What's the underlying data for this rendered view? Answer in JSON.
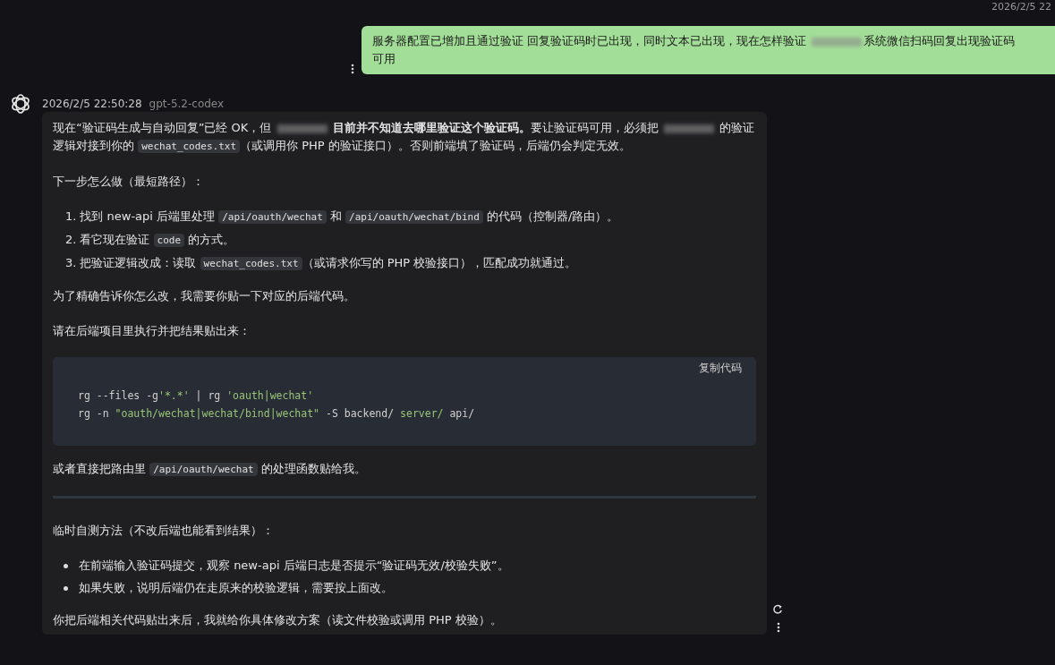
{
  "top_timestamp": "2026/2/5 22",
  "user_message": {
    "lines": [
      [
        {
          "kind": "text",
          "text": "服务器配置已增加且通过验证 回复验证码时已出现，同时文本已出现，现在怎样验证 "
        },
        {
          "kind": "redacted"
        },
        {
          "kind": "text",
          "text": "系统微信扫码回复出现验证码"
        }
      ],
      [
        {
          "kind": "text",
          "text": "可用"
        }
      ]
    ]
  },
  "reply": {
    "timestamp": "2026/2/5 22:50:28",
    "model": "gpt-5.2-codex",
    "blocks": [
      {
        "kind": "paragraph",
        "segments": [
          {
            "kind": "text",
            "text": "现在“验证码生成与自动回复”已经 OK，但 "
          },
          {
            "kind": "redacted"
          },
          {
            "kind": "bold",
            "text": " 目前并不知道去哪里验证这个验证码。"
          },
          {
            "kind": "text",
            "text": "要让验证码可用，必须把 "
          },
          {
            "kind": "redacted"
          },
          {
            "kind": "text",
            "text": " 的验证逻辑对接到你的 "
          },
          {
            "kind": "code",
            "text": "wechat_codes.txt"
          },
          {
            "kind": "text",
            "text": "（或调用你 PHP 的验证接口）。否则前端填了验证码，后端仍会判定无效。"
          }
        ]
      },
      {
        "kind": "paragraph",
        "segments": [
          {
            "kind": "text",
            "text": "下一步怎么做（最短路径）："
          }
        ]
      },
      {
        "kind": "ordered_list",
        "items": [
          {
            "number": "1.",
            "segments": [
              {
                "kind": "text",
                "text": "找到 new-api 后端里处理 "
              },
              {
                "kind": "code",
                "text": "/api/oauth/wechat"
              },
              {
                "kind": "text",
                "text": " 和 "
              },
              {
                "kind": "code",
                "text": "/api/oauth/wechat/bind"
              },
              {
                "kind": "text",
                "text": " 的代码（控制器/路由）。"
              }
            ]
          },
          {
            "number": "2.",
            "segments": [
              {
                "kind": "text",
                "text": "看它现在验证 "
              },
              {
                "kind": "code",
                "text": "code"
              },
              {
                "kind": "text",
                "text": " 的方式。"
              }
            ]
          },
          {
            "number": "3.",
            "segments": [
              {
                "kind": "text",
                "text": "把验证逻辑改成：读取 "
              },
              {
                "kind": "code",
                "text": "wechat_codes.txt"
              },
              {
                "kind": "text",
                "text": "（或请求你写的 PHP 校验接口），匹配成功就通过。"
              }
            ]
          }
        ]
      },
      {
        "kind": "paragraph",
        "segments": [
          {
            "kind": "text",
            "text": "为了精确告诉你怎么改，我需要你贴一下对应的后端代码。"
          }
        ]
      },
      {
        "kind": "paragraph",
        "segments": [
          {
            "kind": "text",
            "text": "请在后端项目里执行并把结果贴出来："
          }
        ]
      },
      {
        "kind": "code_block",
        "copy_label": "复制代码",
        "lines": [
          [
            {
              "kind": "plain",
              "text": "rg --files -g"
            },
            {
              "kind": "string",
              "text": "'*.*'"
            },
            {
              "kind": "plain",
              "text": " | rg "
            },
            {
              "kind": "string",
              "text": "'oauth|wechat'"
            }
          ],
          [
            {
              "kind": "plain",
              "text": "rg -n "
            },
            {
              "kind": "string",
              "text": "\"oauth/wechat|wechat/bind|wechat\""
            },
            {
              "kind": "plain",
              "text": " -S backend/ "
            },
            {
              "kind": "string",
              "text": "server/"
            },
            {
              "kind": "plain",
              "text": " api/"
            }
          ]
        ]
      },
      {
        "kind": "paragraph",
        "segments": [
          {
            "kind": "text",
            "text": "或者直接把路由里 "
          },
          {
            "kind": "code",
            "text": "/api/oauth/wechat"
          },
          {
            "kind": "text",
            "text": " 的处理函数贴给我。"
          }
        ]
      },
      {
        "kind": "divider"
      },
      {
        "kind": "paragraph",
        "segments": [
          {
            "kind": "text",
            "text": "临时自测方法（不改后端也能看到结果）："
          }
        ]
      },
      {
        "kind": "bullet_list",
        "items": [
          {
            "segments": [
              {
                "kind": "text",
                "text": "在前端输入验证码提交，观察 new-api 后端日志是否提示“验证码无效/校验失败”。"
              }
            ]
          },
          {
            "segments": [
              {
                "kind": "text",
                "text": "如果失败，说明后端仍在走原来的校验逻辑，需要按上面改。"
              }
            ]
          }
        ]
      },
      {
        "kind": "paragraph",
        "segments": [
          {
            "kind": "text",
            "text": "你把后端相关代码贴出来后，我就给你具体修改方案（读文件校验或调用 PHP 校验）。"
          }
        ]
      }
    ]
  }
}
